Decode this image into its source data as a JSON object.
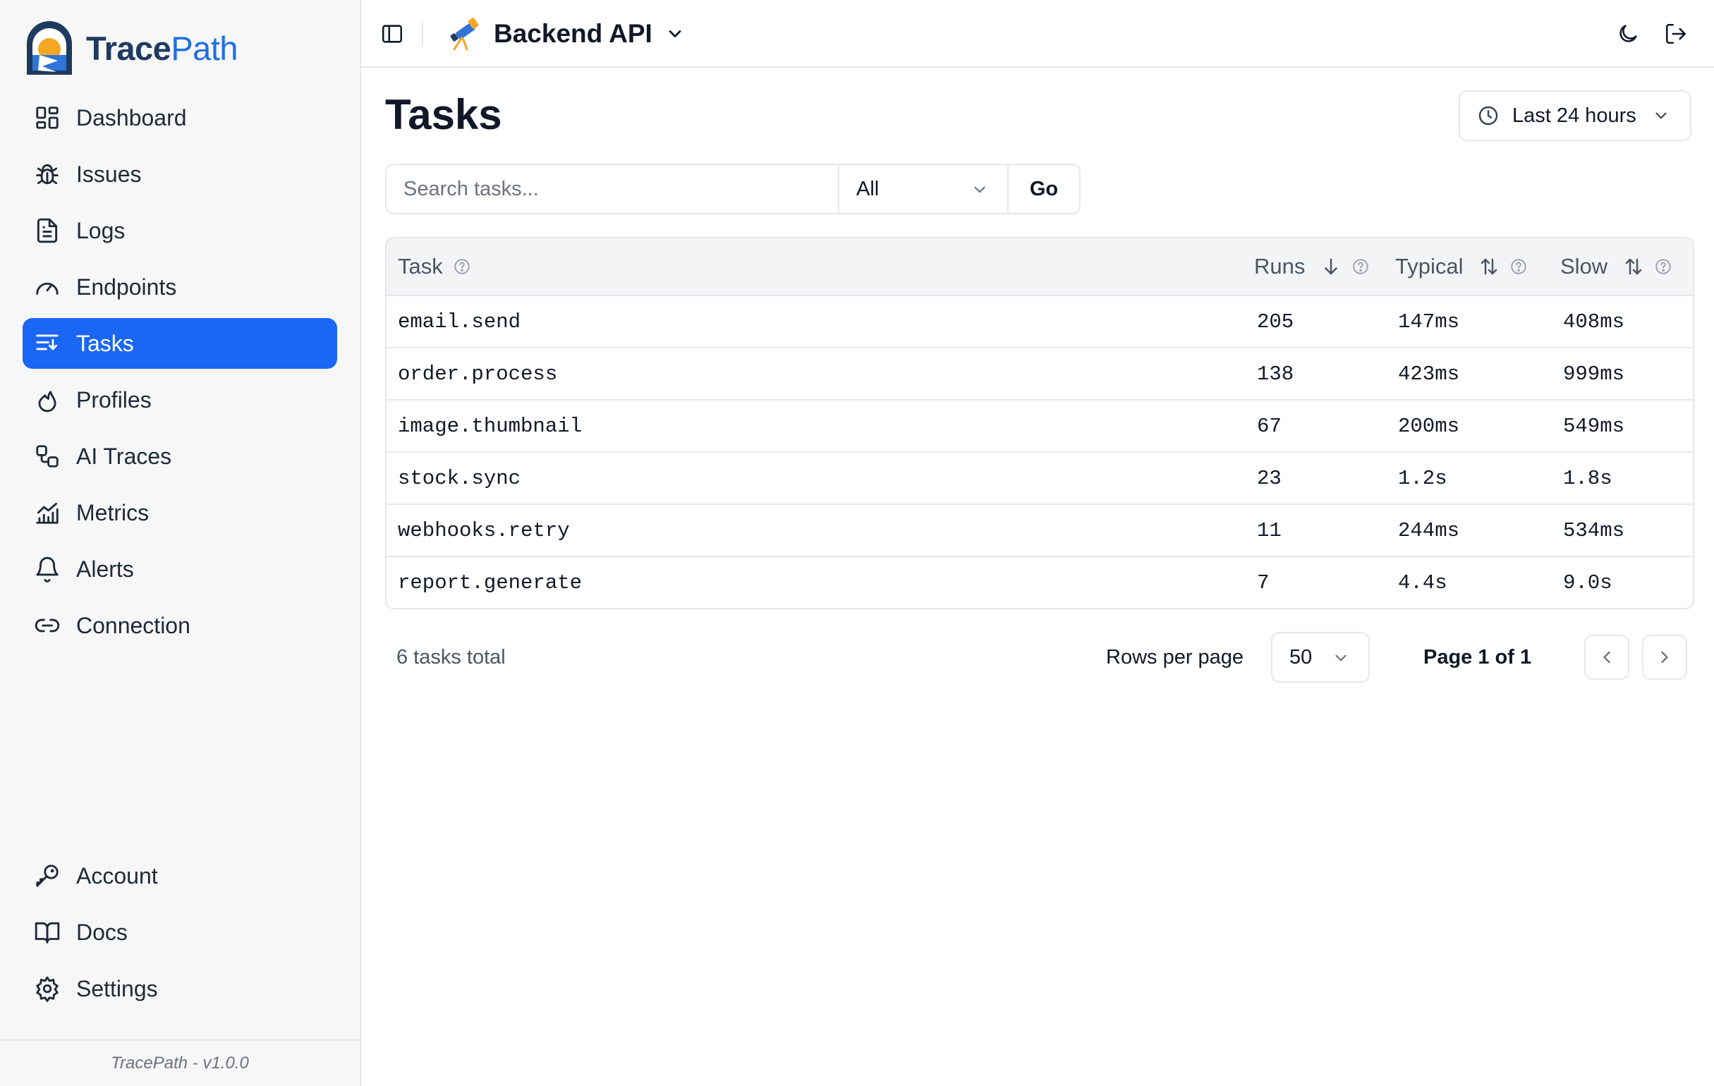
{
  "brand": {
    "part1": "Trace",
    "part2": "Path"
  },
  "sidebar": {
    "items": [
      {
        "label": "Dashboard",
        "icon": "dashboard-icon",
        "active": false
      },
      {
        "label": "Issues",
        "icon": "bug-icon",
        "active": false
      },
      {
        "label": "Logs",
        "icon": "file-text-icon",
        "active": false
      },
      {
        "label": "Endpoints",
        "icon": "gauge-icon",
        "active": false
      },
      {
        "label": "Tasks",
        "icon": "tasks-icon",
        "active": true
      },
      {
        "label": "Profiles",
        "icon": "flame-icon",
        "active": false
      },
      {
        "label": "AI Traces",
        "icon": "workflow-icon",
        "active": false
      },
      {
        "label": "Metrics",
        "icon": "chart-icon",
        "active": false
      },
      {
        "label": "Alerts",
        "icon": "bell-icon",
        "active": false
      },
      {
        "label": "Connection",
        "icon": "link-icon",
        "active": false
      }
    ],
    "bottom_items": [
      {
        "label": "Account",
        "icon": "key-icon"
      },
      {
        "label": "Docs",
        "icon": "book-icon"
      },
      {
        "label": "Settings",
        "icon": "gear-icon"
      }
    ],
    "footer": "TracePath - v1.0.0"
  },
  "topbar": {
    "project_name": "Backend API"
  },
  "page": {
    "title": "Tasks",
    "time_range": "Last 24 hours",
    "search_placeholder": "Search tasks...",
    "filter_value": "All",
    "go_label": "Go"
  },
  "table": {
    "columns": {
      "task": "Task",
      "runs": "Runs",
      "typical": "Typical",
      "slow": "Slow"
    },
    "rows": [
      {
        "task": "email.send",
        "runs": "205",
        "typical": "147ms",
        "slow": "408ms"
      },
      {
        "task": "order.process",
        "runs": "138",
        "typical": "423ms",
        "slow": "999ms"
      },
      {
        "task": "image.thumbnail",
        "runs": "67",
        "typical": "200ms",
        "slow": "549ms"
      },
      {
        "task": "stock.sync",
        "runs": "23",
        "typical": "1.2s",
        "slow": "1.8s"
      },
      {
        "task": "webhooks.retry",
        "runs": "11",
        "typical": "244ms",
        "slow": "534ms"
      },
      {
        "task": "report.generate",
        "runs": "7",
        "typical": "4.4s",
        "slow": "9.0s"
      }
    ]
  },
  "pagination": {
    "total": "6 tasks total",
    "rows_per_page_label": "Rows per page",
    "rows_per_page": "50",
    "page_info": "Page 1 of 1"
  },
  "colors": {
    "accent": "#1a66f5",
    "brand_dark": "#1e3a5f",
    "brand_light": "#1f6fe0",
    "sun": "#f5a623"
  }
}
